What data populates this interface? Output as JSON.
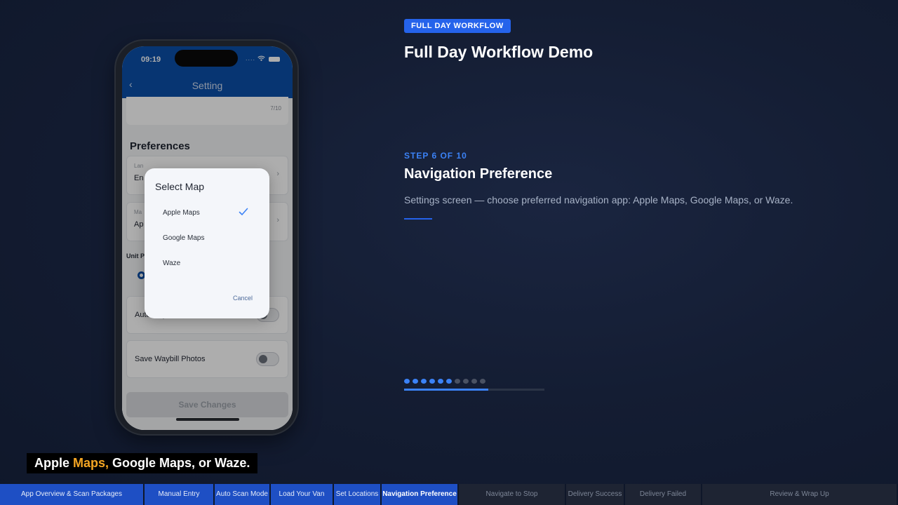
{
  "phone": {
    "status_time": "09:19",
    "status_dots": "....",
    "header_title": "Setting",
    "counter": "7/10",
    "preferences_title": "Preferences",
    "language_field": {
      "label": "Lan",
      "value": "En"
    },
    "map_field": {
      "label": "Ma",
      "value": "Ap"
    },
    "unit_label": "Unit P",
    "auto_capture_label": "Auto Capture",
    "save_photos_label": "Save Waybill Photos",
    "save_button": "Save Changes",
    "dialog": {
      "title": "Select Map",
      "options": [
        "Apple Maps",
        "Google Maps",
        "Waze"
      ],
      "selected_index": 0,
      "cancel": "Cancel"
    }
  },
  "panel": {
    "badge": "FULL DAY WORKFLOW",
    "title": "Full Day Workflow Demo",
    "step_label": "STEP 6 OF 10",
    "step_title": "Navigation Preference",
    "step_desc": "Settings screen — choose preferred navigation app: Apple Maps, Google Maps, or Waze.",
    "current_step": 6,
    "total_steps": 10,
    "progress_fraction": 0.6
  },
  "caption": {
    "before": "Apple ",
    "highlight": "Maps,",
    "after": " Google Maps, or Waze."
  },
  "bottom_nav": [
    {
      "label": "App Overview & Scan Packages",
      "state": "done"
    },
    {
      "label": "Manual Entry",
      "state": "done"
    },
    {
      "label": "Auto Scan Mode",
      "state": "done"
    },
    {
      "label": "Load Your Van",
      "state": "done"
    },
    {
      "label": "Set Locations",
      "state": "done"
    },
    {
      "label": "Navigation Preference",
      "state": "active"
    },
    {
      "label": "Navigate to Stop",
      "state": "todo"
    },
    {
      "label": "Delivery Success",
      "state": "todo"
    },
    {
      "label": "Delivery Failed",
      "state": "todo"
    },
    {
      "label": "Review & Wrap Up",
      "state": "todo"
    }
  ],
  "colors": {
    "accent": "#2563eb",
    "app_header": "#0b4fa8",
    "caption_highlight": "#f5a623"
  }
}
